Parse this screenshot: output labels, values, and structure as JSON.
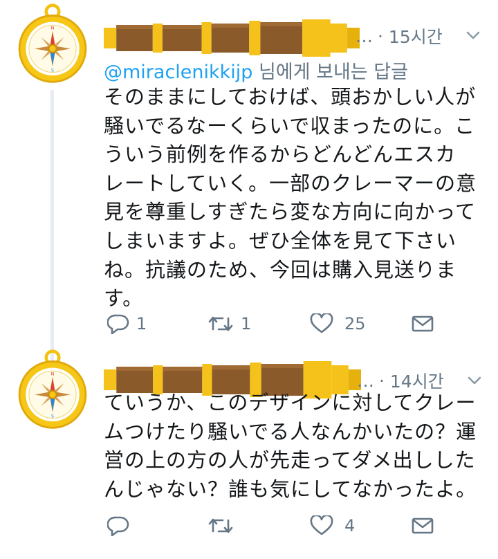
{
  "tweets": [
    {
      "time": "15시간",
      "meta_dots": "…",
      "reply_to": {
        "handle": "@miraclenikkijp",
        "suffix": " 님에게 보내는 답글"
      },
      "text": "そのままにしておけば、頭おかしい人が\n騒いでるなーくらいで収まったのに。こ\nういう前例を作るからどんどんエスカ\nレートしていく。一部のクレーマーの意\n見を尊重しすぎたら変な方向に向かって\nしまいますよ。ぜひ全体を見て下さい\nね。抗議のため、今回は購入見送りま\nす。",
      "actions": {
        "reply_count": "1",
        "retweet_count": "1",
        "like_count": "25"
      }
    },
    {
      "time": "14시간",
      "meta_dots": "…",
      "text": "ていうか、このデザインに対してクレー\nムつけたり騒いでる人なんかいたの？運\n営の上の方の人が先走ってダメ出しした\nんじゃない？誰も気にしてなかったよ。",
      "actions": {
        "reply_count": "",
        "retweet_count": "",
        "like_count": "4"
      }
    }
  ],
  "icons": {
    "avatar": "compass-avatar",
    "name_banner": "telescope-image",
    "caret": "chevron-down-icon",
    "reply": "reply-icon",
    "retweet": "retweet-icon",
    "like": "heart-icon",
    "dm": "envelope-icon"
  },
  "colors": {
    "link": "#1da1f2",
    "meta": "#657786",
    "text": "#14171a",
    "thread_line": "#e6ecf0",
    "gold": "#f5c518",
    "brown": "#8b5a2b"
  }
}
